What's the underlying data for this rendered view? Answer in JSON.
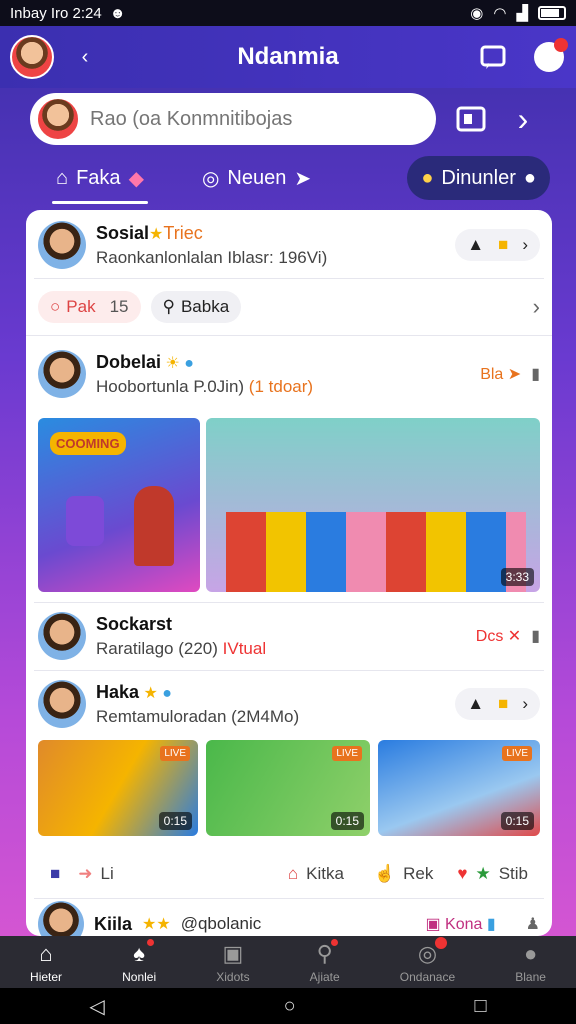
{
  "status": {
    "time": "Inbay Iro 2:24",
    "battery": "battery"
  },
  "header": {
    "title": "Ndanmia"
  },
  "search": {
    "placeholder": "Rao (oa Konmnitibojas"
  },
  "tabs": [
    {
      "label": "Faka"
    },
    {
      "label": "Neuen"
    },
    {
      "label": "Dinunler"
    }
  ],
  "post1": {
    "name": "Sosial",
    "name_tag": "Triec",
    "sub": "Raonkanlonlalan Iblasr: 196Vi)"
  },
  "chips": {
    "left": "Pak",
    "left_count": "15",
    "right": "Babka"
  },
  "post2": {
    "name": "Dobelai",
    "sub": "Hoobortunla P.0Jin)",
    "sub_red": "(1 tdoar)",
    "meta": "Bla",
    "img1_tag": "COOMING",
    "img2_dur": "3:33"
  },
  "post3": {
    "name": "Sockarst",
    "sub": "Raratilago (220)",
    "sub_red": "IVtual",
    "meta": "Dcs"
  },
  "post4": {
    "name": "Haka",
    "sub": "Remtamuloradan (2M4Mo)",
    "thumbs": [
      {
        "tag": "LIVE",
        "dur": "0:15"
      },
      {
        "tag": "LIVE",
        "dur": "0:15"
      },
      {
        "tag": "LIVE",
        "dur": "0:15"
      }
    ]
  },
  "actions": {
    "like": "Li",
    "share": "Kitka",
    "comment": "Rek",
    "save": "Stib"
  },
  "post5": {
    "name": "Kiila",
    "handle": "@qbolanic",
    "meta": "Kona"
  },
  "nav": [
    {
      "label": "Hieter"
    },
    {
      "label": "Nonlei"
    },
    {
      "label": "Xidots"
    },
    {
      "label": "Ajiate"
    },
    {
      "label": "Ondanace"
    },
    {
      "label": "Blane"
    }
  ],
  "colors": {
    "accent": "#3b2fb0",
    "red": "#e33333",
    "orange": "#e8731e"
  }
}
